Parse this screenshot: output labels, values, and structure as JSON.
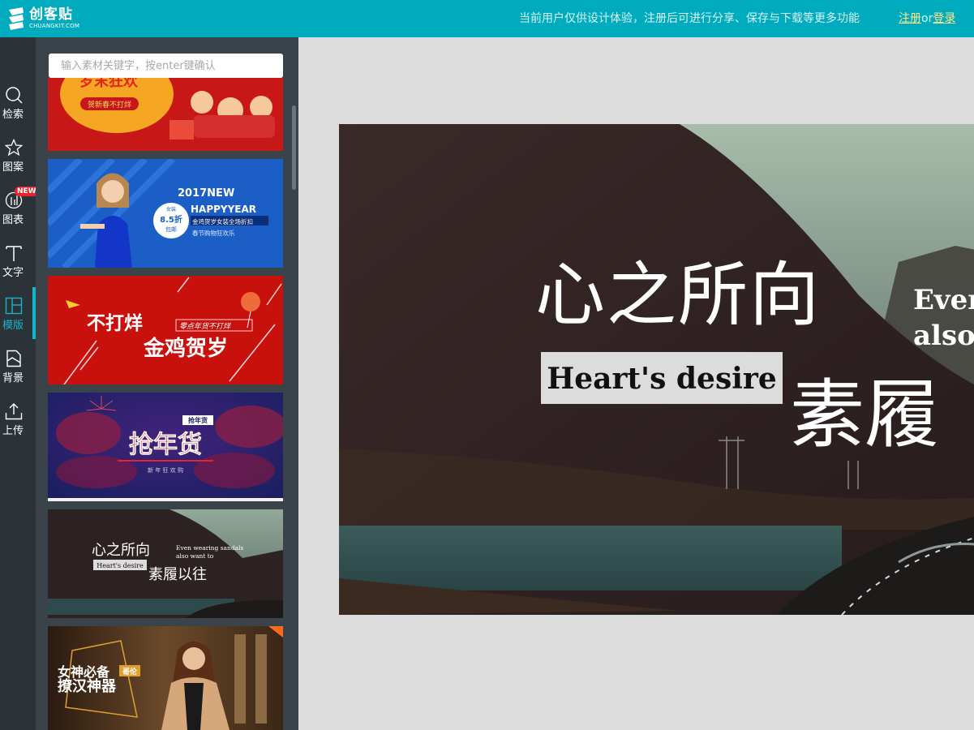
{
  "app": {
    "logo_cn": "创客贴",
    "logo_en": "CHUANGKIT.COM"
  },
  "topbar": {
    "notice": "当前用户仅供设计体验，注册后可进行分享、保存与下载等更多功能",
    "register": "注册",
    "separator": "or",
    "login": "登录"
  },
  "rail": {
    "items": [
      {
        "label": "检索",
        "icon": "search-icon"
      },
      {
        "label": "图案",
        "icon": "star-icon"
      },
      {
        "label": "图表",
        "icon": "chart-icon",
        "badge": "NEW"
      },
      {
        "label": "文字",
        "icon": "text-icon"
      },
      {
        "label": "模版",
        "icon": "template-icon",
        "active": true
      },
      {
        "label": "背景",
        "icon": "background-icon"
      },
      {
        "label": "上传",
        "icon": "upload-icon"
      }
    ]
  },
  "panel": {
    "search_placeholder": "输入素材关键字，按enter键确认",
    "thumbs": [
      {
        "title": "岁末狂欢",
        "sub": "贺新春不打烊"
      },
      {
        "title": "2017NEW",
        "line2": "HAPPYYEAR",
        "line3": "金鸡贺岁女装全场折扣",
        "line4": "春节购物狂欢乐",
        "badge_top": "女装",
        "badge_mid": "8.5折",
        "badge_bot": "包邮"
      },
      {
        "title": "不打烊",
        "line2": "金鸡贺岁",
        "tag": "零点年货不打烊"
      },
      {
        "title": "抢年货",
        "tag": "抢年货",
        "sub": "新 年 狂 欢 购"
      },
      {
        "title": "心之所向",
        "sub": "素履以往",
        "en1": "Even wearing sandals",
        "en2": "also want to",
        "label": "Heart's desire"
      },
      {
        "title": "女神必备",
        "tag": "哥伦",
        "line2": "撩汉神器"
      }
    ]
  },
  "canvas": {
    "title_cn": "心之所向",
    "sub_cn": "素履",
    "label_en": "Heart's desire",
    "en_line1": "Even",
    "en_line2": "also"
  },
  "colors": {
    "topbar": "#00abbd",
    "rail": "#2c3338",
    "panel": "#3a434a",
    "accent": "#17b5c9",
    "workspace": "#dcdcdc"
  }
}
